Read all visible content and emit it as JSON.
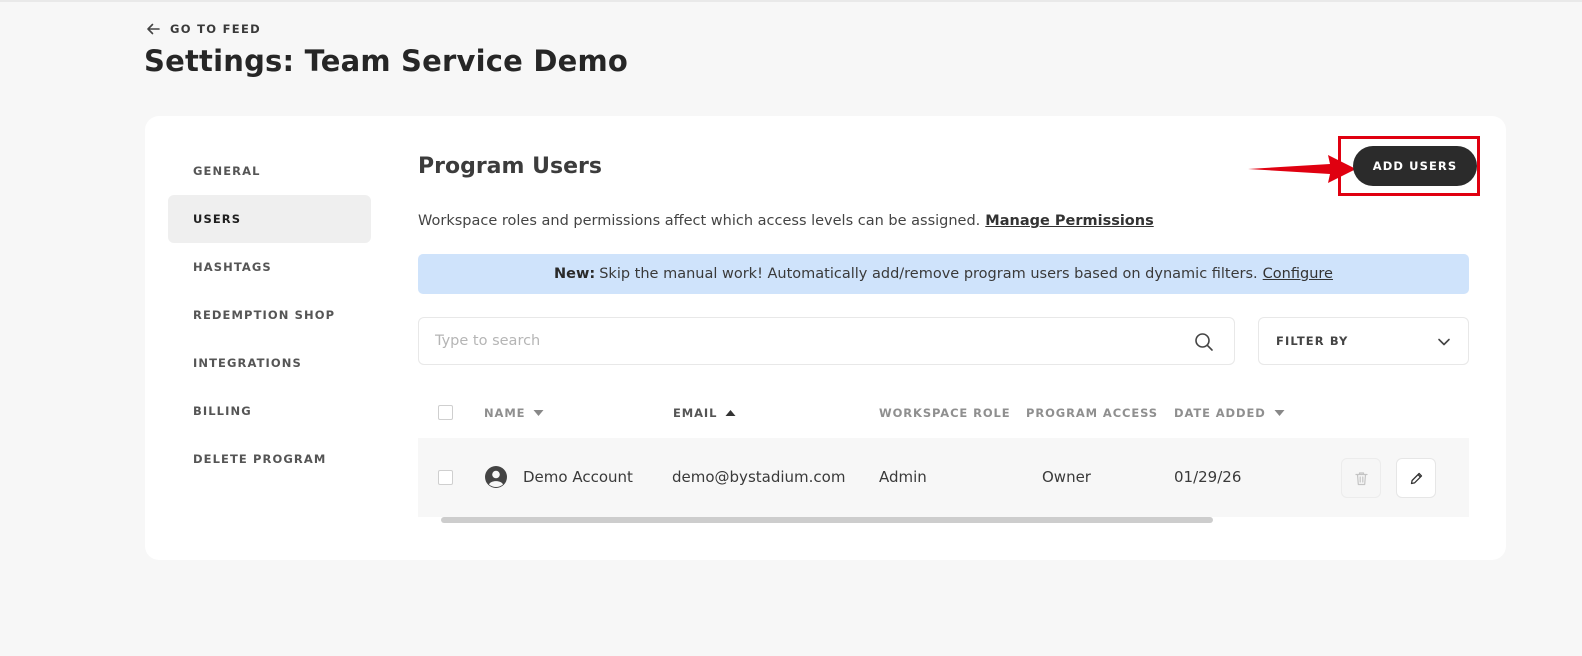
{
  "header": {
    "back_label": "GO TO FEED",
    "title": "Settings: Team Service Demo"
  },
  "sidebar": {
    "items": [
      {
        "label": "GENERAL"
      },
      {
        "label": "USERS",
        "active": true
      },
      {
        "label": "HASHTAGS"
      },
      {
        "label": "REDEMPTION SHOP"
      },
      {
        "label": "INTEGRATIONS"
      },
      {
        "label": "BILLING"
      },
      {
        "label": "DELETE PROGRAM"
      }
    ]
  },
  "main": {
    "title": "Program Users",
    "add_button_label": "ADD USERS",
    "description": "Workspace roles and permissions affect which access levels can be assigned.",
    "manage_link": "Manage Permissions",
    "banner": {
      "strong": "New:",
      "text": "Skip the manual work! Automatically add/remove program users based on dynamic filters.",
      "link": "Configure"
    },
    "search": {
      "placeholder": "Type to search",
      "value": ""
    },
    "filter_label": "FILTER BY",
    "table": {
      "columns": [
        "NAME",
        "EMAIL",
        "WORKSPACE ROLE",
        "PROGRAM ACCESS",
        "DATE ADDED"
      ],
      "rows": [
        {
          "name": "Demo Account",
          "email": "demo@bystadium.com",
          "workspace_role": "Admin",
          "program_access": "Owner",
          "date_added": "01/29/26"
        }
      ]
    }
  },
  "colors": {
    "accent_dark": "#2b2b2b",
    "banner_bg": "#cfe3fb",
    "annotation_red": "#e00010"
  }
}
